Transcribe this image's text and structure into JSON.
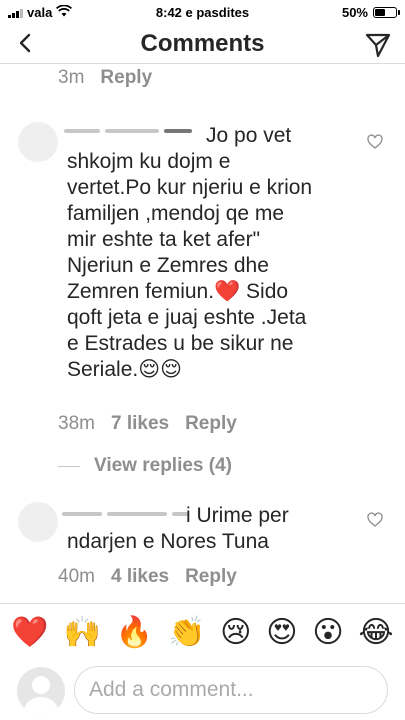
{
  "status_bar": {
    "carrier": "vala",
    "time": "8:42 e pasdites",
    "battery": "50%",
    "battery_level": 0.5,
    "signal_bars": 4,
    "signal_bars_filled": 3,
    "wifi_icon": "wifi-icon"
  },
  "nav": {
    "title": "Comments",
    "back_icon": "chevron-left-icon",
    "send_icon": "paper-plane-icon"
  },
  "top_meta": {
    "time": "3m",
    "reply": "Reply"
  },
  "comments": [
    {
      "lines": [
        "Jo po vet",
        "shkojm ku dojm e",
        "vertet.Po kur njeriu e krion",
        "familjen ,mendoj qe me",
        "mir eshte ta ket afer\"",
        "Njeriun e Zemres  dhe",
        "Zemren  femiun.❤️ Sido",
        "qoft jeta e juaj  eshte .Jeta",
        "e Estrades u be sikur  ne",
        "Seriale.😌😌"
      ],
      "time": "38m",
      "likes": "7 likes",
      "reply": "Reply"
    },
    {
      "lines": [
        "i Urime per",
        "ndarjen e Nores Tuna"
      ],
      "time": "40m",
      "likes": "4 likes",
      "reply": "Reply"
    }
  ],
  "view_replies": "View replies (4)",
  "emoji_bar": [
    "❤️",
    "🙌",
    "🔥",
    "👏",
    "😢",
    "😍",
    "😮",
    "😂"
  ],
  "composer": {
    "placeholder": "Add a comment..."
  },
  "colors": {
    "text": "#262626",
    "secondary": "#8e8e8e",
    "divider": "#dbdbdb"
  }
}
